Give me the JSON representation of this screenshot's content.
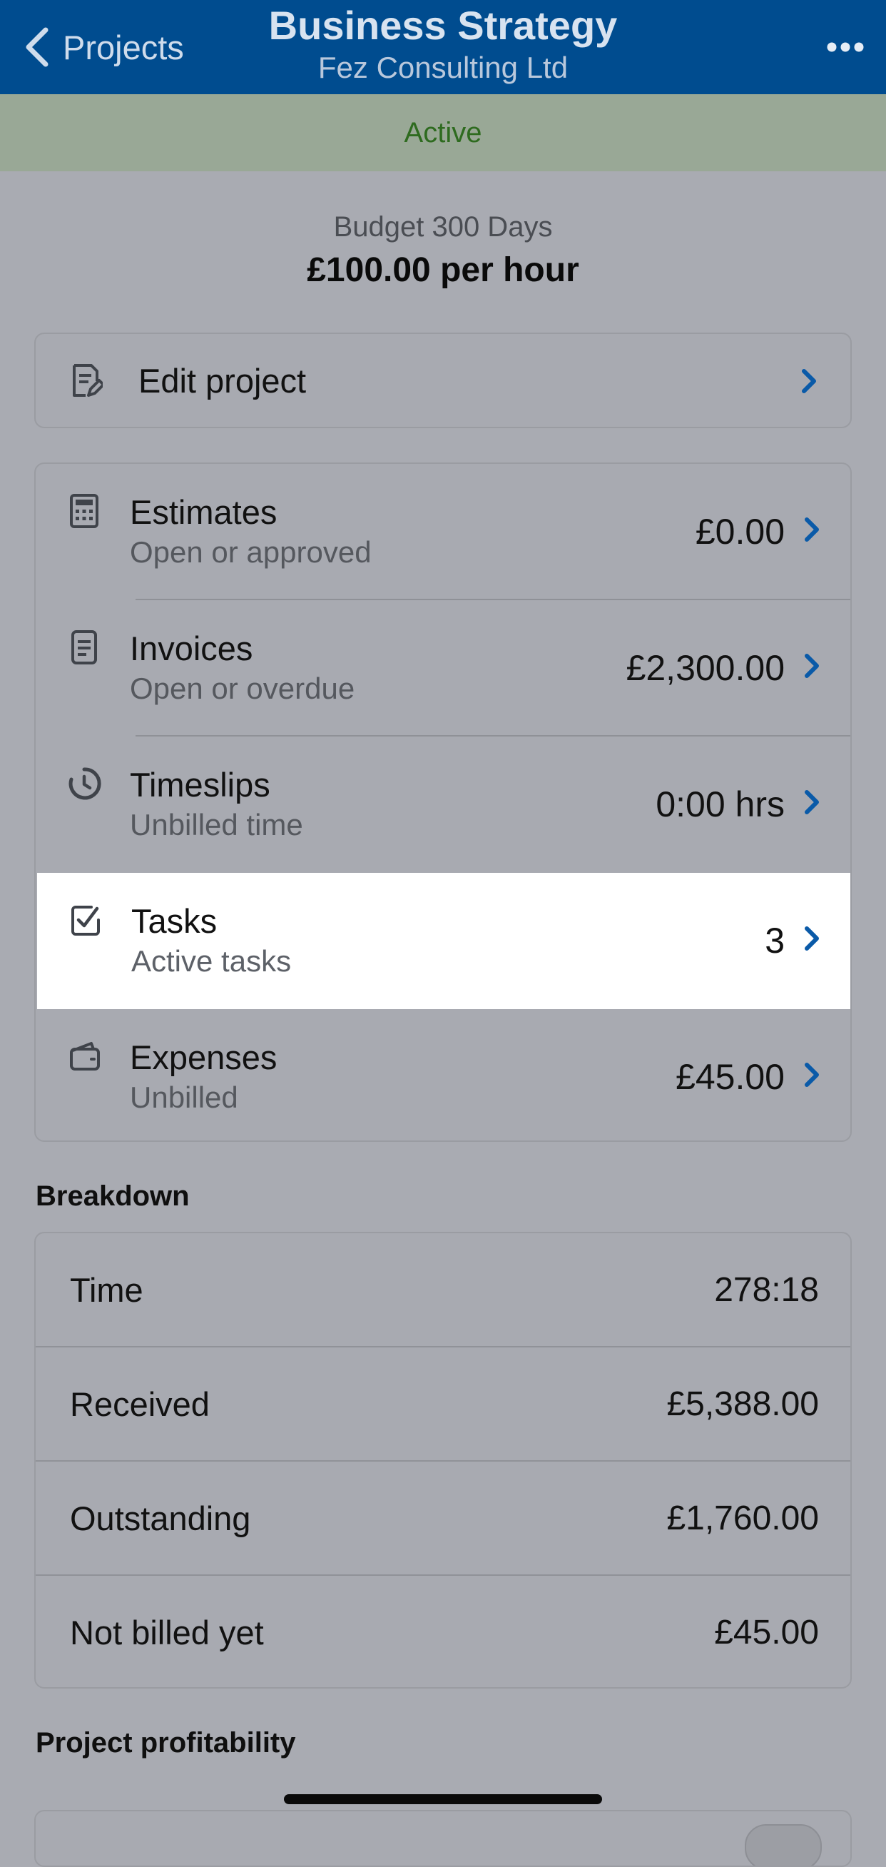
{
  "header": {
    "back_label": "Projects",
    "title": "Business Strategy",
    "subtitle": "Fez Consulting Ltd"
  },
  "status": {
    "label": "Active",
    "color": "#2e6b1f"
  },
  "budget": {
    "label": "Budget 300 Days",
    "rate": "£100.00 per hour"
  },
  "edit_project": {
    "label": "Edit project"
  },
  "summary": {
    "items": [
      {
        "title": "Estimates",
        "subtitle": "Open or approved",
        "value": "£0.00",
        "icon": "calculator-icon"
      },
      {
        "title": "Invoices",
        "subtitle": "Open or overdue",
        "value": "£2,300.00",
        "icon": "document-icon"
      },
      {
        "title": "Timeslips",
        "subtitle": "Unbilled time",
        "value": "0:00 hrs",
        "icon": "clock-icon"
      },
      {
        "title": "Tasks",
        "subtitle": "Active tasks",
        "value": "3",
        "icon": "checkbox-icon"
      },
      {
        "title": "Expenses",
        "subtitle": "Unbilled",
        "value": "£45.00",
        "icon": "wallet-icon"
      }
    ]
  },
  "breakdown": {
    "title": "Breakdown",
    "rows": [
      {
        "label": "Time",
        "value": "278:18"
      },
      {
        "label": "Received",
        "value": "£5,388.00"
      },
      {
        "label": "Outstanding",
        "value": "£1,760.00"
      },
      {
        "label": "Not billed yet",
        "value": "£45.00"
      }
    ]
  },
  "profitability": {
    "title": "Project profitability"
  },
  "colors": {
    "header_bg": "#004c8f",
    "accent_chevron": "#0a5aa8",
    "status_bg": "#99a896"
  }
}
